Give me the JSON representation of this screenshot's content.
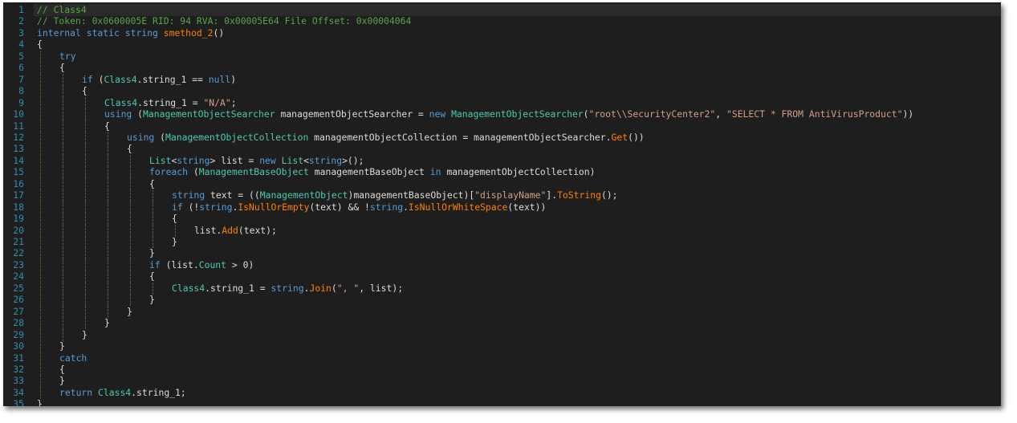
{
  "editor": {
    "lines": [
      {
        "n": "1",
        "indent": 0,
        "tokens": [
          [
            "cm",
            "// Class4"
          ]
        ]
      },
      {
        "n": "2",
        "indent": 0,
        "tokens": [
          [
            "cm",
            "// Token: 0x0600005E RID: 94 RVA: 0x00005E64 File Offset: 0x00004064"
          ]
        ]
      },
      {
        "n": "3",
        "indent": 0,
        "tokens": [
          [
            "kw",
            "internal static string "
          ],
          [
            "mth",
            "smethod_2"
          ],
          [
            "pl",
            "()"
          ]
        ]
      },
      {
        "n": "4",
        "indent": 0,
        "tokens": [
          [
            "pl",
            "{"
          ]
        ]
      },
      {
        "n": "5",
        "indent": 1,
        "tokens": [
          [
            "kw",
            "try"
          ]
        ]
      },
      {
        "n": "6",
        "indent": 1,
        "tokens": [
          [
            "pl",
            "{"
          ]
        ]
      },
      {
        "n": "7",
        "indent": 2,
        "tokens": [
          [
            "kw",
            "if "
          ],
          [
            "pl",
            "("
          ],
          [
            "tp",
            "Class4"
          ],
          [
            "pl",
            ".string_1 == "
          ],
          [
            "kw",
            "null"
          ],
          [
            "pl",
            ")"
          ]
        ]
      },
      {
        "n": "8",
        "indent": 2,
        "tokens": [
          [
            "pl",
            "{"
          ]
        ]
      },
      {
        "n": "9",
        "indent": 3,
        "tokens": [
          [
            "tp",
            "Class4"
          ],
          [
            "pl",
            ".string_1 = "
          ],
          [
            "str",
            "\"N/A\""
          ],
          [
            "pl",
            ";"
          ]
        ]
      },
      {
        "n": "10",
        "indent": 3,
        "tokens": [
          [
            "kw",
            "using "
          ],
          [
            "pl",
            "("
          ],
          [
            "tp",
            "ManagementObjectSearcher"
          ],
          [
            "pl",
            " managementObjectSearcher = "
          ],
          [
            "kw",
            "new "
          ],
          [
            "tp",
            "ManagementObjectSearcher"
          ],
          [
            "pl",
            "("
          ],
          [
            "str",
            "\"root\\\\SecurityCenter2\""
          ],
          [
            "pl",
            ", "
          ],
          [
            "str",
            "\"SELECT * FROM AntiVirusProduct\""
          ],
          [
            "pl",
            "))"
          ]
        ]
      },
      {
        "n": "11",
        "indent": 3,
        "tokens": [
          [
            "pl",
            "{"
          ]
        ]
      },
      {
        "n": "12",
        "indent": 4,
        "tokens": [
          [
            "kw",
            "using "
          ],
          [
            "pl",
            "("
          ],
          [
            "tp",
            "ManagementObjectCollection"
          ],
          [
            "pl",
            " managementObjectCollection = managementObjectSearcher."
          ],
          [
            "mth",
            "Get"
          ],
          [
            "pl",
            "())"
          ]
        ]
      },
      {
        "n": "13",
        "indent": 4,
        "tokens": [
          [
            "pl",
            "{"
          ]
        ]
      },
      {
        "n": "14",
        "indent": 5,
        "tokens": [
          [
            "tp",
            "List"
          ],
          [
            "pl",
            "<"
          ],
          [
            "kw",
            "string"
          ],
          [
            "pl",
            "> list = "
          ],
          [
            "kw",
            "new "
          ],
          [
            "tp",
            "List"
          ],
          [
            "pl",
            "<"
          ],
          [
            "kw",
            "string"
          ],
          [
            "pl",
            ">();"
          ]
        ]
      },
      {
        "n": "15",
        "indent": 5,
        "tokens": [
          [
            "kw",
            "foreach "
          ],
          [
            "pl",
            "("
          ],
          [
            "tp",
            "ManagementBaseObject"
          ],
          [
            "pl",
            " managementBaseObject "
          ],
          [
            "kw",
            "in"
          ],
          [
            "pl",
            " managementObjectCollection)"
          ]
        ]
      },
      {
        "n": "16",
        "indent": 5,
        "tokens": [
          [
            "pl",
            "{"
          ]
        ]
      },
      {
        "n": "17",
        "indent": 6,
        "tokens": [
          [
            "kw",
            "string"
          ],
          [
            "pl",
            " text = (("
          ],
          [
            "tp",
            "ManagementObject"
          ],
          [
            "pl",
            ")managementBaseObject)["
          ],
          [
            "str",
            "\"displayName\""
          ],
          [
            "pl",
            "]."
          ],
          [
            "mth",
            "ToString"
          ],
          [
            "pl",
            "();"
          ]
        ]
      },
      {
        "n": "18",
        "indent": 6,
        "tokens": [
          [
            "kw",
            "if "
          ],
          [
            "pl",
            "(!"
          ],
          [
            "kw",
            "string"
          ],
          [
            "pl",
            "."
          ],
          [
            "mth",
            "IsNullOrEmpty"
          ],
          [
            "pl",
            "(text) && !"
          ],
          [
            "kw",
            "string"
          ],
          [
            "pl",
            "."
          ],
          [
            "mth",
            "IsNullOrWhiteSpace"
          ],
          [
            "pl",
            "(text))"
          ]
        ]
      },
      {
        "n": "19",
        "indent": 6,
        "tokens": [
          [
            "pl",
            "{"
          ]
        ]
      },
      {
        "n": "20",
        "indent": 7,
        "tokens": [
          [
            "pl",
            "list."
          ],
          [
            "mth",
            "Add"
          ],
          [
            "pl",
            "(text);"
          ]
        ]
      },
      {
        "n": "21",
        "indent": 6,
        "tokens": [
          [
            "pl",
            "}"
          ]
        ]
      },
      {
        "n": "22",
        "indent": 5,
        "tokens": [
          [
            "pl",
            "}"
          ]
        ]
      },
      {
        "n": "23",
        "indent": 5,
        "tokens": [
          [
            "kw",
            "if "
          ],
          [
            "pl",
            "(list."
          ],
          [
            "prop",
            "Count"
          ],
          [
            "pl",
            " > 0)"
          ]
        ]
      },
      {
        "n": "24",
        "indent": 5,
        "tokens": [
          [
            "pl",
            "{"
          ]
        ]
      },
      {
        "n": "25",
        "indent": 6,
        "tokens": [
          [
            "tp",
            "Class4"
          ],
          [
            "pl",
            ".string_1 = "
          ],
          [
            "kw",
            "string"
          ],
          [
            "pl",
            "."
          ],
          [
            "mth",
            "Join"
          ],
          [
            "pl",
            "("
          ],
          [
            "str",
            "\", \""
          ],
          [
            "pl",
            ", list);"
          ]
        ]
      },
      {
        "n": "26",
        "indent": 5,
        "tokens": [
          [
            "pl",
            "}"
          ]
        ]
      },
      {
        "n": "27",
        "indent": 4,
        "tokens": [
          [
            "pl",
            "}"
          ]
        ]
      },
      {
        "n": "28",
        "indent": 3,
        "tokens": [
          [
            "pl",
            "}"
          ]
        ]
      },
      {
        "n": "29",
        "indent": 2,
        "tokens": [
          [
            "pl",
            "}"
          ]
        ]
      },
      {
        "n": "30",
        "indent": 1,
        "tokens": [
          [
            "pl",
            "}"
          ]
        ]
      },
      {
        "n": "31",
        "indent": 1,
        "tokens": [
          [
            "kw",
            "catch"
          ]
        ]
      },
      {
        "n": "32",
        "indent": 1,
        "tokens": [
          [
            "pl",
            "{"
          ]
        ]
      },
      {
        "n": "33",
        "indent": 1,
        "tokens": [
          [
            "pl",
            "}"
          ]
        ]
      },
      {
        "n": "34",
        "indent": 1,
        "tokens": [
          [
            "kw",
            "return "
          ],
          [
            "tp",
            "Class4"
          ],
          [
            "pl",
            ".string_1;"
          ]
        ]
      },
      {
        "n": "35",
        "indent": 0,
        "tokens": [
          [
            "pl",
            "}"
          ]
        ]
      }
    ]
  },
  "colors": {
    "background": "#1e1e1e",
    "line_number": "#2b91af",
    "keyword": "#569cd6",
    "type": "#4ec9b0",
    "string": "#d69d85",
    "comment": "#57a64a",
    "method": "#ff8000",
    "plain": "#dcdcdc"
  }
}
